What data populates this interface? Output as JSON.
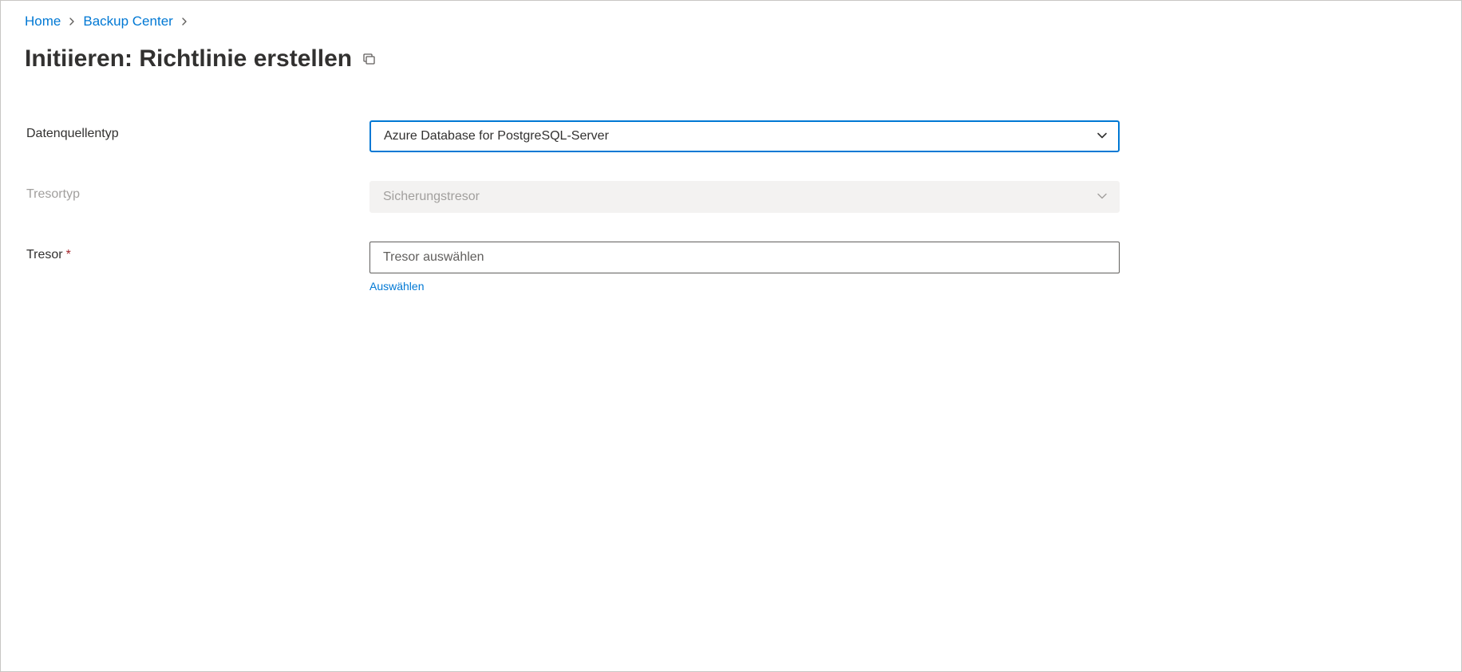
{
  "breadcrumb": {
    "items": [
      {
        "label": "Home"
      },
      {
        "label": "Backup Center"
      }
    ]
  },
  "header": {
    "title": "Initiieren: Richtlinie erstellen"
  },
  "form": {
    "datasource_type": {
      "label": "Datenquellentyp",
      "value": "Azure Database for PostgreSQL-Server"
    },
    "vault_type": {
      "label": "Tresortyp",
      "value": "Sicherungstresor"
    },
    "vault": {
      "label": "Tresor",
      "placeholder": "Tresor auswählen",
      "value": "",
      "select_link": "Auswählen"
    }
  }
}
